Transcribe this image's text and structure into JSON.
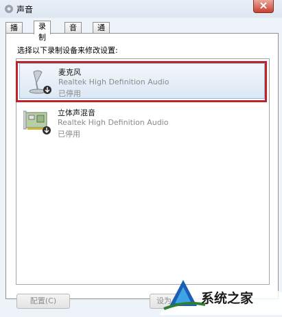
{
  "window": {
    "title": "声音"
  },
  "tabs": [
    {
      "label": "播放",
      "active": false
    },
    {
      "label": "录制",
      "active": true
    },
    {
      "label": "音音",
      "active": false
    },
    {
      "label": "通信",
      "active": false
    }
  ],
  "instruction": "选择以下录制设备来修改设置:",
  "devices": [
    {
      "name": "麦克风",
      "driver": "Realtek High Definition Audio",
      "status": "已停用",
      "icon": "microphone-icon",
      "selected": true
    },
    {
      "name": "立体声混音",
      "driver": "Realtek High Definition Audio",
      "status": "已停用",
      "icon": "sound-card-icon",
      "selected": false
    }
  ],
  "buttons": {
    "configure": "配置(C)",
    "set_default": "设为"
  },
  "watermark": {
    "text": "系统之家"
  },
  "colors": {
    "highlight_border": "#c0222a",
    "selection_bg": "#dce8f5",
    "watermark_blue": "#1a5fb4"
  }
}
